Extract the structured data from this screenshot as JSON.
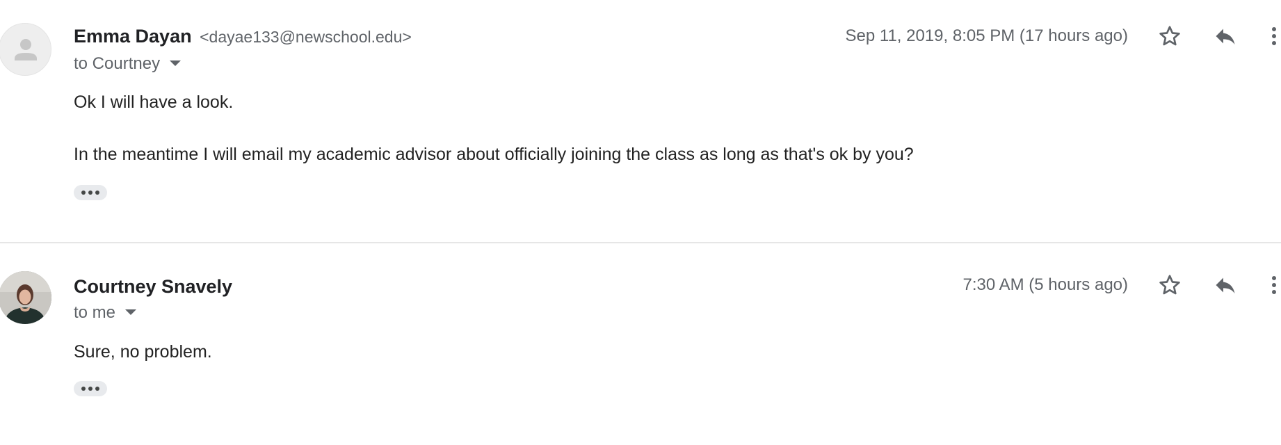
{
  "messages": [
    {
      "sender_name": "Emma Dayan",
      "sender_email": "<dayae133@newschool.edu>",
      "recipient": "to Courtney",
      "timestamp": "Sep 11, 2019, 8:05 PM (17 hours ago)",
      "avatar": "default-person-icon",
      "body": [
        "Ok I will have a look.",
        "In the meantime I will email my academic advisor about officially joining the class as long as that's ok by you?"
      ]
    },
    {
      "sender_name": "Courtney Snavely",
      "recipient": "to me",
      "timestamp": "7:30 AM (5 hours ago)",
      "avatar": "profile-photo",
      "body": [
        "Sure, no problem."
      ]
    }
  ],
  "icons": {
    "star": "star-outline-icon",
    "reply": "reply-icon",
    "more": "more-vert-icon",
    "show_trimmed": "ellipsis-icon"
  },
  "colors": {
    "text_primary": "#202124",
    "text_secondary": "#5f6368",
    "icon": "#5f6368",
    "divider": "#e6e6e6",
    "pill": "#e8eaed"
  }
}
